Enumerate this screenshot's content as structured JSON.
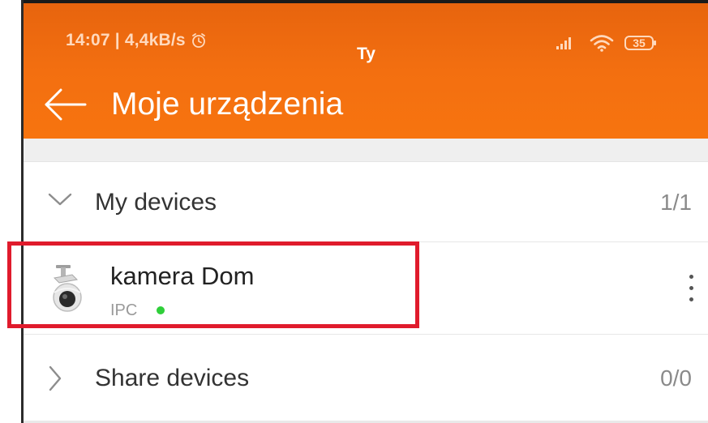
{
  "status_bar": {
    "time_speed": "14:07 | 4,4kB/s",
    "center_text": "Ty",
    "battery_level": "35",
    "icons": [
      "alarm-clock-icon",
      "signal-icon",
      "wifi-icon",
      "battery-icon"
    ]
  },
  "toolbar": {
    "back_icon": "arrow-left-icon",
    "title": "Moje urządzenia"
  },
  "groups": [
    {
      "label": "My devices",
      "count": "1/1",
      "expanded": true,
      "chevron": "chevron-down-icon"
    },
    {
      "label": "Share devices",
      "count": "0/0",
      "expanded": false,
      "chevron": "chevron-right-icon"
    }
  ],
  "device": {
    "name": "kamera Dom",
    "type": "IPC",
    "online": true,
    "thumbnail_icon": "security-camera-icon",
    "menu_icon": "more-vertical-icon"
  },
  "colors": {
    "header": "#f36f10",
    "highlight": "#e01b2c",
    "online": "#2fcf3a"
  }
}
